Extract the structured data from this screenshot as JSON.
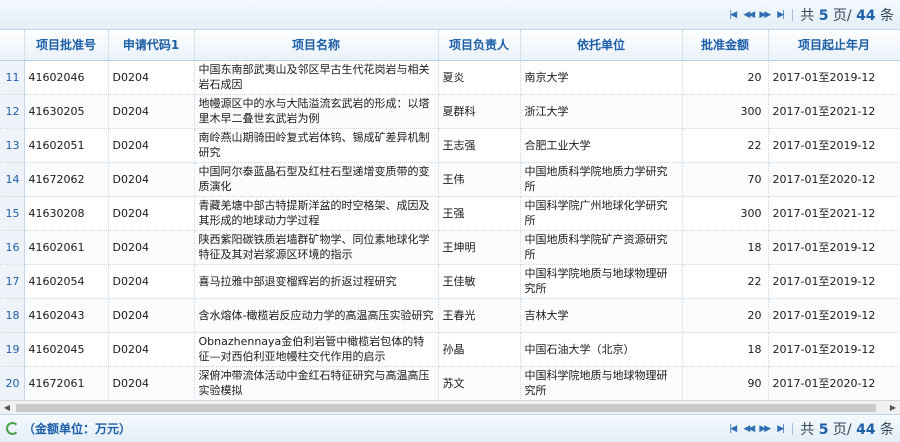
{
  "pager": {
    "first_icon": "first-page-icon",
    "prev_icon": "prev-page-icon",
    "next_icon": "next-page-icon",
    "last_icon": "last-page-icon",
    "total_prefix": "共",
    "total_pages": "5",
    "page_sep": "页/",
    "total_items": "44",
    "total_suffix": "条"
  },
  "footer": {
    "amount_note": "（金额单位：万元）",
    "refresh_icon": "refresh-icon"
  },
  "table": {
    "columns": [
      "项目批准号",
      "申请代码1",
      "项目名称",
      "项目负责人",
      "依托单位",
      "批准金额",
      "项目起止年月"
    ],
    "rows": [
      {
        "rn": "11",
        "id": "41602046",
        "code": "D0204",
        "name": "中国东南部武夷山及邻区早古生代花岗岩与相关岩石成因",
        "pi": "夏炎",
        "org": "南京大学",
        "amount": "20",
        "period": "2017-01至2019-12"
      },
      {
        "rn": "12",
        "id": "41630205",
        "code": "D0204",
        "name": "地幔源区中的水与大陆溢流玄武岩的形成：以塔里木早二叠世玄武岩为例",
        "pi": "夏群科",
        "org": "浙江大学",
        "amount": "300",
        "period": "2017-01至2021-12"
      },
      {
        "rn": "13",
        "id": "41602051",
        "code": "D0204",
        "name": "南岭燕山期骑田岭复式岩体钨、锡成矿差异机制研究",
        "pi": "王志强",
        "org": "合肥工业大学",
        "amount": "22",
        "period": "2017-01至2019-12"
      },
      {
        "rn": "14",
        "id": "41672062",
        "code": "D0204",
        "name": "中国阿尔泰蓝晶石型及红柱石型递增变质带的变质演化",
        "pi": "王伟",
        "org": "中国地质科学院地质力学研究所",
        "amount": "70",
        "period": "2017-01至2020-12"
      },
      {
        "rn": "15",
        "id": "41630208",
        "code": "D0204",
        "name": "青藏羌塘中部古特提斯洋盆的时空格架、成因及其形成的地球动力学过程",
        "pi": "王强",
        "org": "中国科学院广州地球化学研究所",
        "amount": "300",
        "period": "2017-01至2021-12"
      },
      {
        "rn": "16",
        "id": "41602061",
        "code": "D0204",
        "name": "陕西紫阳碳铁质岩墙群矿物学、同位素地球化学特征及其对岩浆源区环境的指示",
        "pi": "王坤明",
        "org": "中国地质科学院矿产资源研究所",
        "amount": "18",
        "period": "2017-01至2019-12"
      },
      {
        "rn": "17",
        "id": "41602054",
        "code": "D0204",
        "name": "喜马拉雅中部退变榴辉岩的折返过程研究",
        "pi": "王佳敏",
        "org": "中国科学院地质与地球物理研究所",
        "amount": "22",
        "period": "2017-01至2019-12"
      },
      {
        "rn": "18",
        "id": "41602043",
        "code": "D0204",
        "name": "含水熔体-橄榄岩反应动力学的高温高压实验研究",
        "pi": "王春光",
        "org": "吉林大学",
        "amount": "20",
        "period": "2017-01至2019-12"
      },
      {
        "rn": "19",
        "id": "41602045",
        "code": "D0204",
        "name": "Obnazhennaya金伯利岩管中橄榄岩包体的特征—对西伯利亚地幔柱交代作用的启示",
        "pi": "孙晶",
        "org": "中国石油大学（北京）",
        "amount": "18",
        "period": "2017-01至2019-12"
      },
      {
        "rn": "20",
        "id": "41672061",
        "code": "D0204",
        "name": "深俯冲带流体活动中金红石特征研究与高温高压实验模拟",
        "pi": "苏文",
        "org": "中国科学院地质与地球物理研究所",
        "amount": "90",
        "period": "2017-01至2020-12"
      }
    ]
  },
  "scrollbar": {
    "left_icon": "scroll-left-icon",
    "right_icon": "scroll-right-icon"
  }
}
